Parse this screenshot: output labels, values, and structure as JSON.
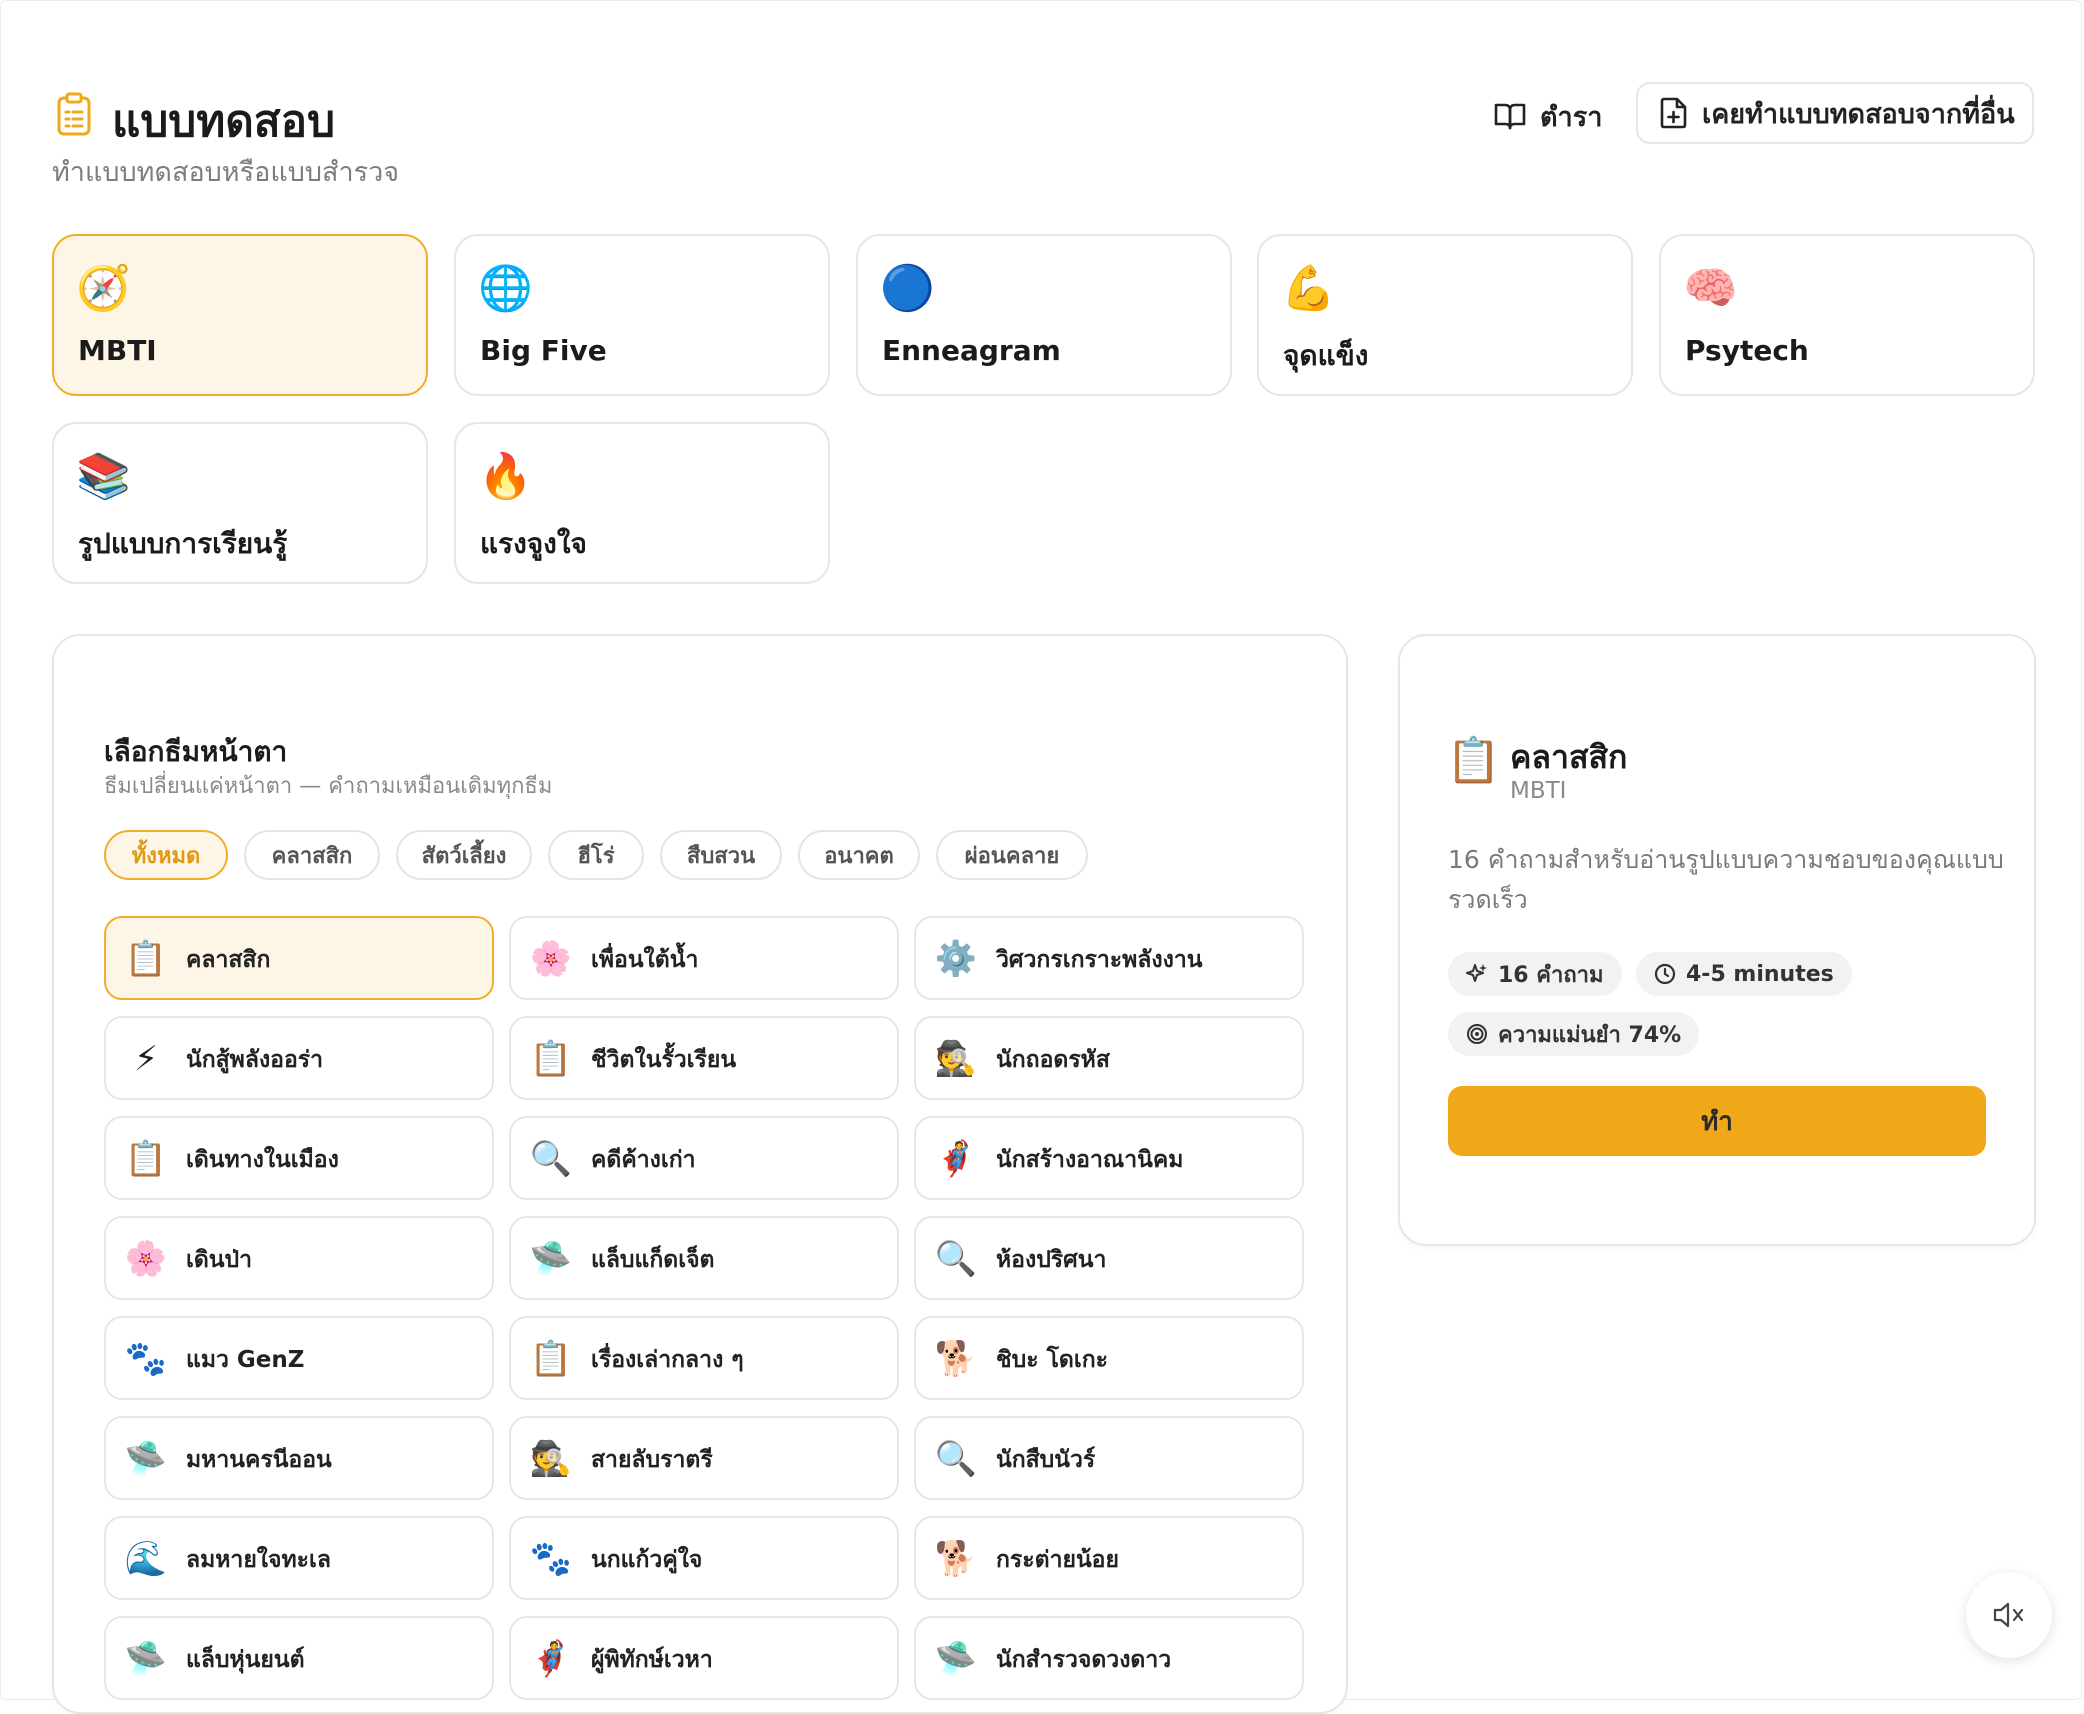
{
  "header": {
    "title": "แบบทดสอบ",
    "subtitle": "ทำแบบทดสอบหรือแบบสำรวจ",
    "textbook_label": "ตำรา",
    "import_label": "เคยทำแบบทดสอบจากที่อื่น"
  },
  "test_types": [
    {
      "emoji": "🧭",
      "label": "MBTI",
      "active": true
    },
    {
      "emoji": "🌐",
      "label": "Big Five"
    },
    {
      "emoji": "🔵",
      "label": "Enneagram"
    },
    {
      "emoji": "💪",
      "label": "จุดแข็ง"
    },
    {
      "emoji": "🧠",
      "label": "Psytech"
    },
    {
      "emoji": "📚",
      "label": "รูปแบบการเรียนรู้"
    },
    {
      "emoji": "🔥",
      "label": "แรงจูงใจ"
    }
  ],
  "themes": {
    "title": "เลือกธีมหน้าตา",
    "subtitle": "ธีมเปลี่ยนแค่หน้าตา — คำถามเหมือนเดิมทุกธีม",
    "filters": [
      "ทั้งหมด",
      "คลาสสิก",
      "สัตว์เลี้ยง",
      "ฮีโร่",
      "สืบสวน",
      "อนาคต",
      "ผ่อนคลาย"
    ],
    "items": [
      {
        "emoji": "📋",
        "label": "คลาสสิก"
      },
      {
        "emoji": "🌸",
        "label": "เพื่อนใต้น้ำ"
      },
      {
        "emoji": "⚙️",
        "label": "วิศวกรเกราะพลังงาน"
      },
      {
        "emoji": "⚡",
        "label": "นักสู้พลังออร่า"
      },
      {
        "emoji": "📋",
        "label": "ชีวิตในรั้วเรียน"
      },
      {
        "emoji": "🕵️",
        "label": "นักถอดรหัส"
      },
      {
        "emoji": "📋",
        "label": "เดินทางในเมือง"
      },
      {
        "emoji": "🔍",
        "label": "คดีค้างเก่า"
      },
      {
        "emoji": "🦸",
        "label": "นักสร้างอาณานิคม"
      },
      {
        "emoji": "🌸",
        "label": "เดินป่า"
      },
      {
        "emoji": "🛸",
        "label": "แล็บแก็ดเจ็ต"
      },
      {
        "emoji": "🔍",
        "label": "ห้องปริศนา"
      },
      {
        "emoji": "🐾",
        "label": "แมว GenZ"
      },
      {
        "emoji": "📋",
        "label": "เรื่องเล่ากลาง ๆ"
      },
      {
        "emoji": "🐕",
        "label": "ชิบะ โดเกะ"
      },
      {
        "emoji": "🛸",
        "label": "มหานครนีออน"
      },
      {
        "emoji": "🕵️",
        "label": "สายลับราตรี"
      },
      {
        "emoji": "🔍",
        "label": "นักสืบนัวร์"
      },
      {
        "emoji": "🌊",
        "label": "ลมหายใจทะเล"
      },
      {
        "emoji": "🐾",
        "label": "นกแก้วคู่ใจ"
      },
      {
        "emoji": "🐕",
        "label": "กระต่ายน้อย"
      },
      {
        "emoji": "🛸",
        "label": "แล็บหุ่นยนต์"
      },
      {
        "emoji": "🦸",
        "label": "ผู้พิทักษ์เวหา"
      },
      {
        "emoji": "🛸",
        "label": "นักสำรวจดวงดาว"
      }
    ]
  },
  "detail": {
    "emoji": "📋",
    "title": "คลาสสิก",
    "subtitle": "MBTI",
    "description": "16 คำถามสำหรับอ่านรูปแบบความชอบของคุณแบบรวดเร็ว",
    "questions": "16 คำถาม",
    "duration": "4-5 minutes",
    "accuracy": "ความแม่นยำ 74%",
    "action_label": "ทำ"
  },
  "colors": {
    "accent": "#f0a81a",
    "accent_bg": "#fdf6e6",
    "border": "#e6e6e6"
  }
}
